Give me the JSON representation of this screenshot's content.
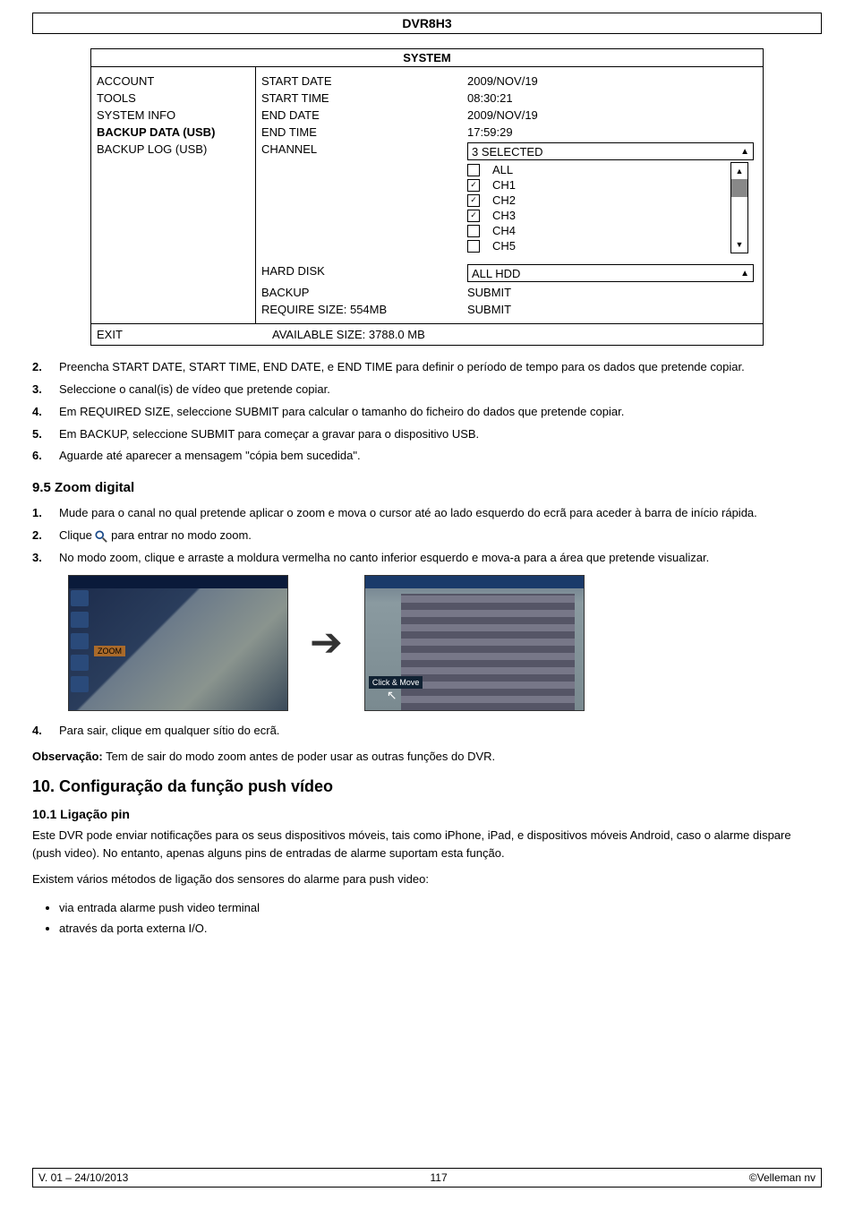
{
  "header": {
    "model": "DVR8H3"
  },
  "system": {
    "title": "SYSTEM",
    "menu": [
      {
        "label": "ACCOUNT",
        "bold": false
      },
      {
        "label": "TOOLS",
        "bold": false
      },
      {
        "label": "SYSTEM INFO",
        "bold": false
      },
      {
        "label": "BACKUP DATA (USB)",
        "bold": true
      },
      {
        "label": "BACKUP LOG (USB)",
        "bold": false
      }
    ],
    "fields": {
      "start_date_label": "START DATE",
      "start_date_value": "2009/NOV/19",
      "start_time_label": "START TIME",
      "start_time_value": "08:30:21",
      "end_date_label": "END DATE",
      "end_date_value": "2009/NOV/19",
      "end_time_label": "END TIME",
      "end_time_value": "17:59:29",
      "channel_label": "CHANNEL",
      "channel_selected": "3 SELECTED",
      "channel_options": [
        {
          "label": "ALL",
          "checked": false
        },
        {
          "label": "CH1",
          "checked": true
        },
        {
          "label": "CH2",
          "checked": true
        },
        {
          "label": "CH3",
          "checked": true
        },
        {
          "label": "CH4",
          "checked": false
        },
        {
          "label": "CH5",
          "checked": false
        }
      ],
      "hard_disk_label": "HARD DISK",
      "hard_disk_value": "ALL HDD",
      "backup_label": "BACKUP",
      "backup_value": "SUBMIT",
      "require_size_label": "REQUIRE SIZE: 554MB",
      "require_size_value": "SUBMIT"
    },
    "exit": "EXIT",
    "available": "AVAILABLE SIZE: 3788.0 MB"
  },
  "steps_a": [
    {
      "n": "2.",
      "t": "Preencha START DATE, START TIME, END DATE, e END TIME para definir o período de tempo para os dados que pretende copiar."
    },
    {
      "n": "3.",
      "t": "Seleccione o canal(is) de vídeo que pretende copiar."
    },
    {
      "n": "4.",
      "t": "Em REQUIRED SIZE, seleccione SUBMIT para calcular o tamanho do ficheiro do dados que pretende copiar."
    },
    {
      "n": "5.",
      "t": "Em BACKUP, seleccione SUBMIT para começar a gravar para o dispositivo USB."
    },
    {
      "n": "6.",
      "t": "Aguarde até aparecer a mensagem \"cópia bem sucedida\"."
    }
  ],
  "sec95": {
    "title": "9.5   Zoom digital"
  },
  "steps_b": [
    {
      "n": "1.",
      "t": "Mude para o canal no qual pretende aplicar o zoom e mova o cursor até ao lado esquerdo do ecrã para aceder à barra de início rápida."
    },
    {
      "n": "2.",
      "pre": "Clique ",
      "post": " para entrar no modo zoom."
    },
    {
      "n": "3.",
      "t": "No modo zoom, clique e arraste a moldura vermelha no canto inferior esquerdo e mova-a para a área que pretende visualizar."
    }
  ],
  "zoom_images": {
    "tag_left": "ZOOM",
    "tag_right": "Click & Move"
  },
  "step_b4": {
    "n": "4.",
    "t": "Para sair, clique em qualquer sítio do ecrã."
  },
  "obs_label": "Observação:",
  "obs_text": " Tem de sair do modo zoom antes de poder usar as outras funções do DVR.",
  "sec10": {
    "title": "10.   Configuração da função push vídeo"
  },
  "sec101": {
    "title": "10.1  Ligação pin"
  },
  "p101a": "Este DVR pode enviar notificações para os seus dispositivos móveis, tais como iPhone, iPad, e dispositivos móveis Android, caso o alarme dispare (push video). No entanto, apenas alguns pins de entradas de alarme suportam esta função.",
  "p101b": "Existem vários métodos de ligação dos sensores do alarme para push video:",
  "bullets": [
    "via entrada alarme push video terminal",
    "através da porta externa I/O."
  ],
  "footer": {
    "left": "V. 01 – 24/10/2013",
    "center": "117",
    "right": "©Velleman nv"
  }
}
